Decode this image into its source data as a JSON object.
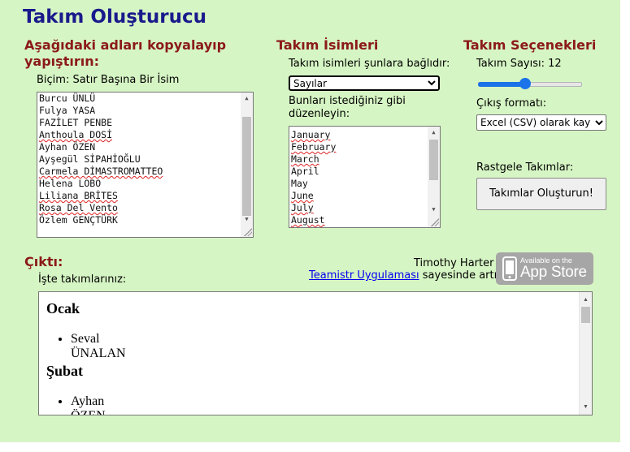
{
  "app": {
    "title": "Takım Oluşturucu"
  },
  "names_section": {
    "heading": "Aşağıdaki adları kopyalayıp yapıştırın:",
    "format_label": "Biçim: Satır Başına Bir İsim",
    "names": [
      {
        "text": "Burcu ÜNLÜ",
        "flag": false
      },
      {
        "text": "Fulya YASA",
        "flag": false
      },
      {
        "text": "FAZİLET PENBE",
        "flag": false
      },
      {
        "text": "Anthoula DOSİ",
        "flag": true
      },
      {
        "text": "Ayhan ÖZEN",
        "flag": false
      },
      {
        "text": "Ayşegül SİPAHİOĞLU",
        "flag": false
      },
      {
        "text": "Carmela DİMASTROMATTEO",
        "flag": true
      },
      {
        "text": "Helena LOBO",
        "flag": false
      },
      {
        "text": "Liliana BRİTES",
        "flag": true
      },
      {
        "text": "Rosa Del Vento",
        "flag": true
      },
      {
        "text": "Özlem GENÇTÜRK",
        "flag": false
      }
    ]
  },
  "team_names_section": {
    "heading": "Takım İsimleri",
    "depends_label": "Takım isimleri şunlara bağlıdır:",
    "depends_value": "Sayılar",
    "edit_label": "Bunları istediğiniz gibi düzenleyin:",
    "team_names": [
      {
        "text": "January",
        "flag": true
      },
      {
        "text": "February",
        "flag": true
      },
      {
        "text": "March",
        "flag": true
      },
      {
        "text": "April",
        "flag": false
      },
      {
        "text": "May",
        "flag": false
      },
      {
        "text": "June",
        "flag": true
      },
      {
        "text": "July",
        "flag": true
      },
      {
        "text": "August",
        "flag": true
      }
    ]
  },
  "options_section": {
    "heading": "Takım Seçenekleri",
    "team_count_label": "Takım Sayısı: 12",
    "team_count_level": 0.45,
    "output_format_label": "Çıkış formatı:",
    "output_format_value": "Excel (CSV) olarak kay",
    "random_teams_label": "Rastgele Takımlar:",
    "create_button": "Takımlar Oluşturun!"
  },
  "output_section": {
    "heading": "Çıktı:",
    "your_teams_label": "İşte takımlarınız:",
    "credit_author": "Timothy Harter",
    "credit_link": "Teamistr Uygulaması",
    "credit_suffix": " sayesinde artık:",
    "appstore_small": "Available on the",
    "appstore_big": "App Store",
    "teams": [
      {
        "name": "Ocak",
        "members": [
          "Seval ÜNALAN"
        ]
      },
      {
        "name": "Şubat",
        "members": [
          "Ayhan ÖZEN"
        ]
      }
    ]
  }
}
